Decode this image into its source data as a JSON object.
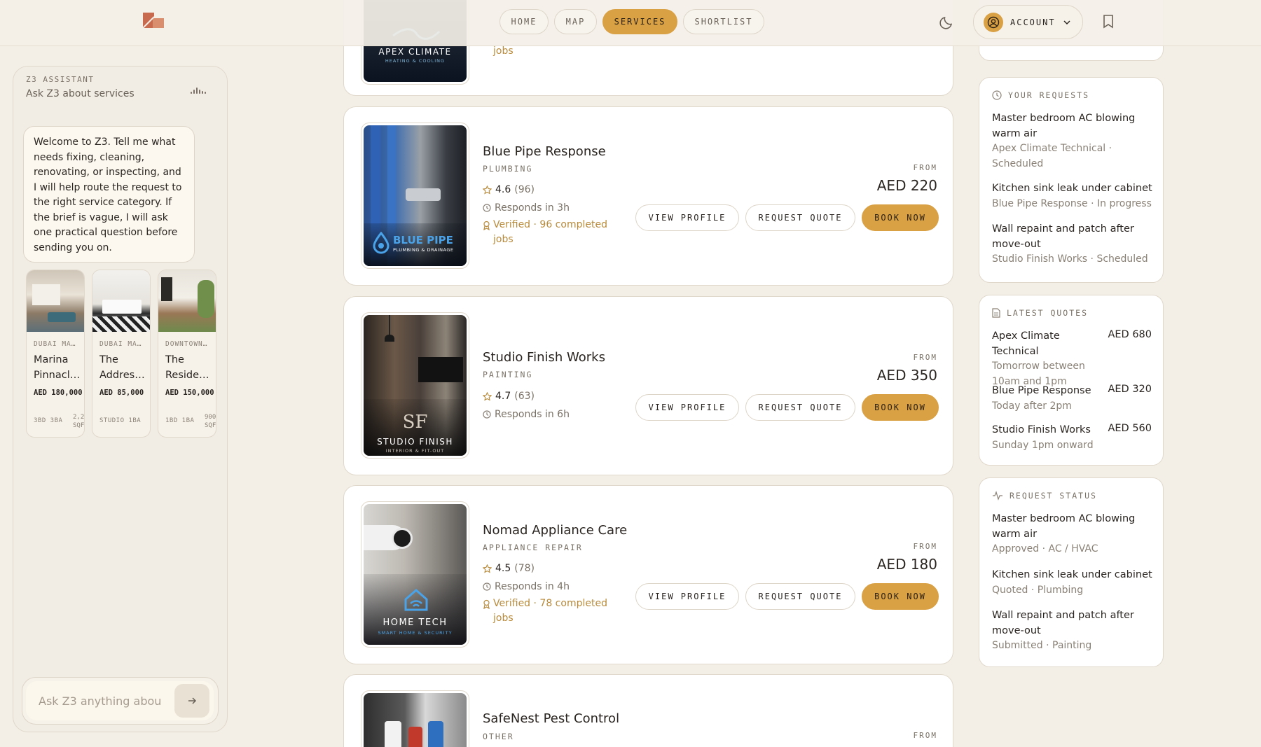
{
  "header": {
    "nav": [
      {
        "label": "HOME",
        "active": false
      },
      {
        "label": "MAP",
        "active": false
      },
      {
        "label": "SERVICES",
        "active": true
      },
      {
        "label": "SHORTLIST",
        "active": false
      }
    ],
    "account_label": "ACCOUNT"
  },
  "assistant": {
    "kicker": "Z3 ASSISTANT",
    "subtitle": "Ask Z3 about services",
    "welcome": "Welcome to Z3. Tell me what needs fixing, cleaning, renovating, or inspecting, and I will help route the request to the right service category. If the brief is vague, I will ask one practical question before sending you on.",
    "properties": [
      {
        "location": "DUBAI MA…",
        "name": "Marina Pinnacl…",
        "price": "AED 180,000",
        "meta": "3BD  3BA",
        "area": "2,2 SQF"
      },
      {
        "location": "DUBAI MA…",
        "name": "The Addres…",
        "price": "AED 85,000",
        "meta": "STUDIO  1BA",
        "area": ""
      },
      {
        "location": "DOWNTOWN…",
        "name": "The Reside…",
        "price": "AED 150,000",
        "meta": "1BD  1BA",
        "area": "900 SQF"
      }
    ],
    "input_placeholder": "Ask Z3 anything abou"
  },
  "services": [
    {
      "name": "",
      "category": "",
      "brand": "APEX CLIMATE",
      "brand_sub": "HEATING & COOLING",
      "verified": "jobs"
    },
    {
      "name": "Blue Pipe Response",
      "category": "PLUMBING",
      "rating": "4.6",
      "reviews": "(96)",
      "responds": "Responds in 3h",
      "verified": "Verified · 96 completed jobs",
      "from": "FROM",
      "price": "AED 220",
      "brand": "BLUE PIPE",
      "brand_sub": "PLUMBING & DRAINAGE"
    },
    {
      "name": "Studio Finish Works",
      "category": "PAINTING",
      "rating": "4.7",
      "reviews": "(63)",
      "responds": "Responds in 6h",
      "verified": "",
      "from": "FROM",
      "price": "AED 350",
      "brand": "STUDIO FINISH",
      "brand_sub": "INTERIOR & FIT-OUT",
      "monogram": "SF"
    },
    {
      "name": "Nomad Appliance Care",
      "category": "APPLIANCE REPAIR",
      "rating": "4.5",
      "reviews": "(78)",
      "responds": "Responds in 4h",
      "verified": "Verified · 78 completed jobs",
      "from": "FROM",
      "price": "AED 180",
      "brand": "HOME TECH",
      "brand_sub": "SMART HOME & SECURITY"
    },
    {
      "name": "SafeNest Pest Control",
      "category": "OTHER",
      "from": "FROM"
    }
  ],
  "buttons": {
    "view_profile": "VIEW PROFILE",
    "request_quote": "REQUEST QUOTE",
    "book_now": "BOOK NOW"
  },
  "requests": {
    "title": "YOUR REQUESTS",
    "items": [
      {
        "title": "Master bedroom AC blowing warm air",
        "sub": "Apex Climate Technical · Scheduled"
      },
      {
        "title": "Kitchen sink leak under cabinet",
        "sub": "Blue Pipe Response · In progress"
      },
      {
        "title": "Wall repaint and patch after move-out",
        "sub": "Studio Finish Works · Scheduled"
      }
    ]
  },
  "quotes": {
    "title": "LATEST QUOTES",
    "items": [
      {
        "name": "Apex Climate Technical",
        "amount": "AED 680",
        "when": "Tomorrow between 10am and 1pm"
      },
      {
        "name": "Blue Pipe Response",
        "amount": "AED 320",
        "when": "Today after 2pm"
      },
      {
        "name": "Studio Finish Works",
        "amount": "AED 560",
        "when": "Sunday 1pm onward"
      }
    ]
  },
  "status": {
    "title": "REQUEST STATUS",
    "items": [
      {
        "title": "Master bedroom AC blowing warm air",
        "sub": "Approved · AC / HVAC"
      },
      {
        "title": "Kitchen sink leak under cabinet",
        "sub": "Quoted · Plumbing"
      },
      {
        "title": "Wall repaint and patch after move-out",
        "sub": "Submitted · Painting"
      }
    ]
  },
  "colors": {
    "accent": "#d9a044",
    "background": "#f3efe7",
    "verified": "#b88a3a"
  }
}
